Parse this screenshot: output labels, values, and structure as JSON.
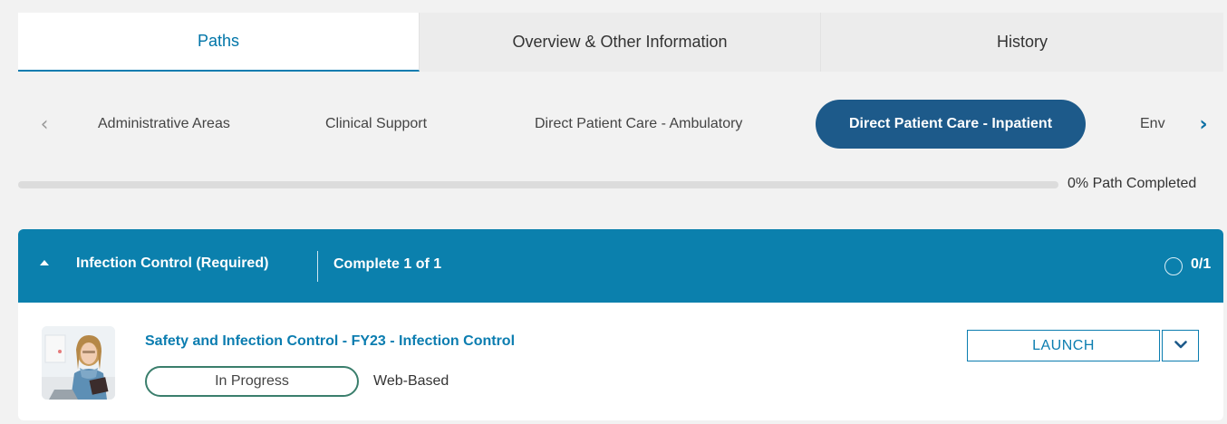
{
  "tabs": [
    {
      "label": "Paths",
      "active": true
    },
    {
      "label": "Overview & Other Information",
      "active": false
    },
    {
      "label": "History",
      "active": false
    }
  ],
  "carousel": {
    "prev_icon": "chevron-left-icon",
    "next_icon": "chevron-right-icon",
    "categories": [
      {
        "label": "Administrative Areas"
      },
      {
        "label": "Clinical Support"
      },
      {
        "label": "Direct Patient Care - Ambulatory"
      },
      {
        "label": "Direct Patient Care - Inpatient",
        "selected": true
      },
      {
        "label": "Env"
      }
    ]
  },
  "progress": {
    "percent": 0,
    "label": "0% Path Completed"
  },
  "section": {
    "title": "Infection Control  (Required)",
    "completion": "Complete 1 of 1",
    "count": "0/1",
    "collapse_icon": "caret-up-icon"
  },
  "course": {
    "title": "Safety and Infection Control - FY23 - Infection Control",
    "status": "In Progress",
    "type": "Web-Based",
    "launch_label": "LAUNCH",
    "dropdown_icon": "chevron-down-icon"
  },
  "colors": {
    "primary": "#0b80ad",
    "selected_pill": "#1d5a8a",
    "status_border": "#3a7e6c",
    "background": "#f2f2f2"
  }
}
